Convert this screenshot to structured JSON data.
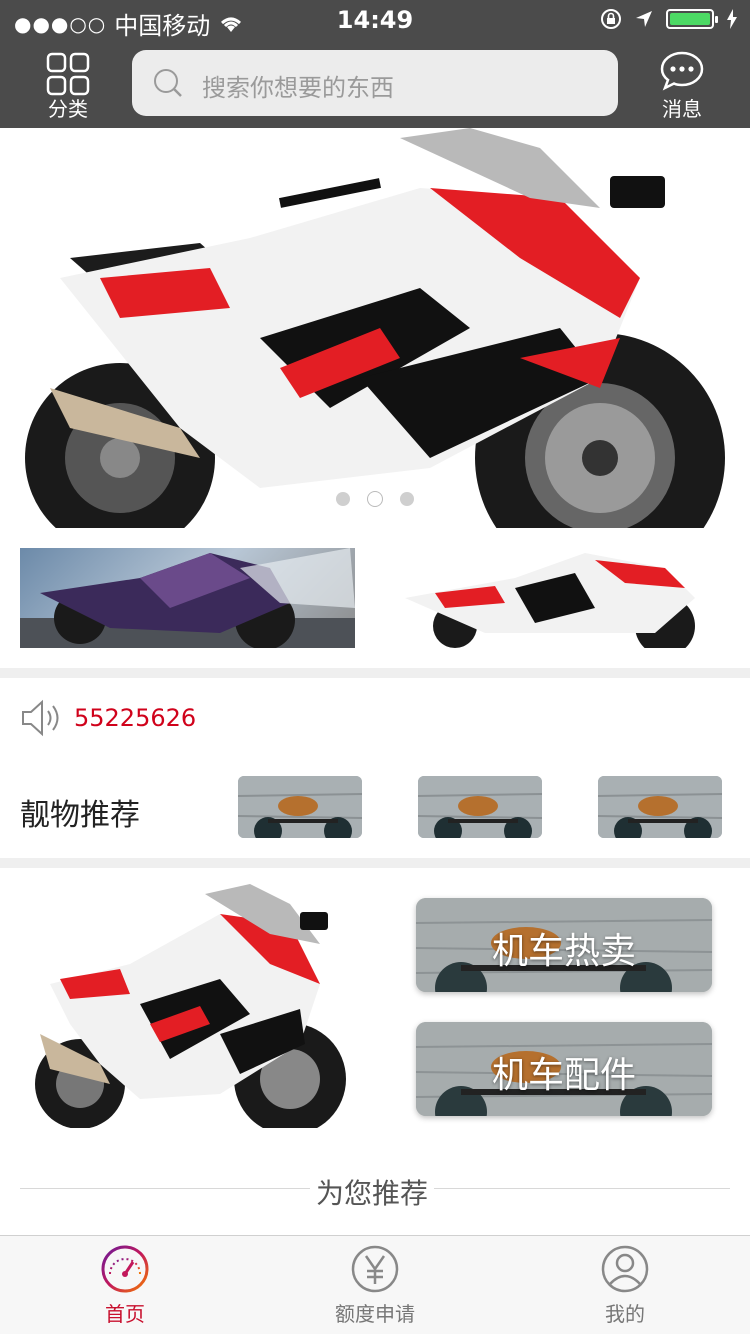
{
  "status_bar": {
    "signal": "●●●○○",
    "carrier": "中国移动",
    "time": "14:49"
  },
  "header": {
    "category_label": "分类",
    "search_placeholder": "搜索你想要的东西",
    "messages_label": "消息"
  },
  "banner": {
    "slide_count": 3,
    "active_slide": 2
  },
  "notice": {
    "text": "55225626"
  },
  "recommend": {
    "title": "靓物推荐"
  },
  "promo": {
    "card1": "机车热卖",
    "card2": "机车配件"
  },
  "for_you": {
    "label": "为您推荐"
  },
  "tabbar": {
    "tabs": [
      {
        "label": "首页"
      },
      {
        "label": "额度申请"
      },
      {
        "label": "我的"
      }
    ]
  },
  "colors": {
    "header_bg": "#4b4b4b",
    "accent_red": "#d0021b",
    "battery_green": "#4cd964"
  }
}
